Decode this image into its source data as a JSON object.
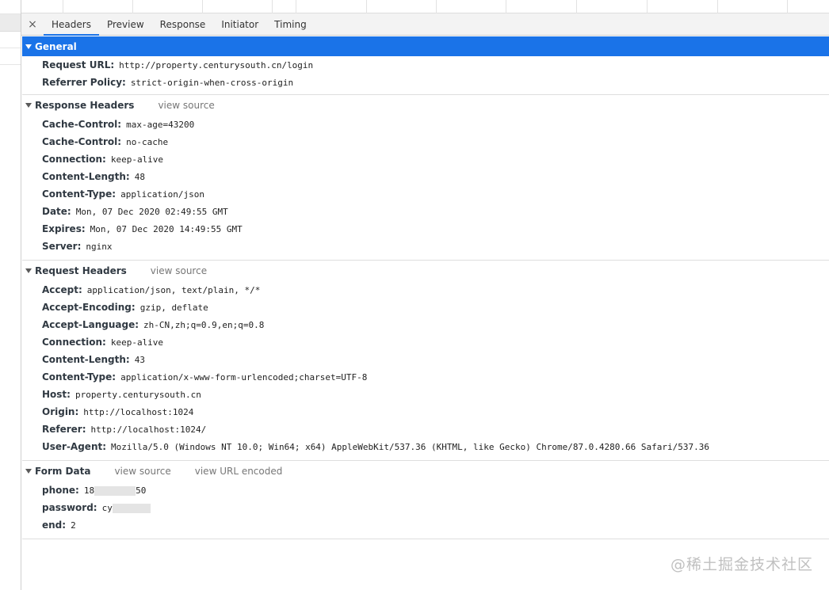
{
  "tabs": {
    "close": "×",
    "items": [
      "Headers",
      "Preview",
      "Response",
      "Initiator",
      "Timing"
    ],
    "active": "Headers"
  },
  "general": {
    "title": "General",
    "rows": [
      {
        "key": "Request URL:",
        "value": "http://property.centurysouth.cn/login"
      },
      {
        "key": "Referrer Policy:",
        "value": "strict-origin-when-cross-origin"
      }
    ]
  },
  "response_headers": {
    "title": "Response Headers",
    "view_source": "view source",
    "rows": [
      {
        "key": "Cache-Control:",
        "value": "max-age=43200"
      },
      {
        "key": "Cache-Control:",
        "value": "no-cache"
      },
      {
        "key": "Connection:",
        "value": "keep-alive"
      },
      {
        "key": "Content-Length:",
        "value": "48"
      },
      {
        "key": "Content-Type:",
        "value": "application/json"
      },
      {
        "key": "Date:",
        "value": "Mon, 07 Dec 2020 02:49:55 GMT"
      },
      {
        "key": "Expires:",
        "value": "Mon, 07 Dec 2020 14:49:55 GMT"
      },
      {
        "key": "Server:",
        "value": "nginx"
      }
    ]
  },
  "request_headers": {
    "title": "Request Headers",
    "view_source": "view source",
    "rows": [
      {
        "key": "Accept:",
        "value": "application/json, text/plain, */*"
      },
      {
        "key": "Accept-Encoding:",
        "value": "gzip, deflate"
      },
      {
        "key": "Accept-Language:",
        "value": "zh-CN,zh;q=0.9,en;q=0.8"
      },
      {
        "key": "Connection:",
        "value": "keep-alive"
      },
      {
        "key": "Content-Length:",
        "value": "43"
      },
      {
        "key": "Content-Type:",
        "value": "application/x-www-form-urlencoded;charset=UTF-8"
      },
      {
        "key": "Host:",
        "value": "property.centurysouth.cn"
      },
      {
        "key": "Origin:",
        "value": "http://localhost:1024"
      },
      {
        "key": "Referer:",
        "value": "http://localhost:1024/"
      },
      {
        "key": "User-Agent:",
        "value": "Mozilla/5.0 (Windows NT 10.0; Win64; x64) AppleWebKit/537.36 (KHTML, like Gecko) Chrome/87.0.4280.66 Safari/537.36"
      }
    ]
  },
  "form_data": {
    "title": "Form Data",
    "view_source": "view source",
    "view_url_encoded": "view URL encoded",
    "rows": [
      {
        "key": "phone:",
        "value_prefix": "18",
        "value_suffix": "50"
      },
      {
        "key": "password:",
        "value_prefix": "cy",
        "value_suffix": ""
      },
      {
        "key": "end:",
        "value_prefix": "2",
        "value_suffix": ""
      }
    ]
  },
  "watermark": "@稀土掘金技术社区",
  "colors": {
    "selected_header": "#1a73e8",
    "tab_underline": "#1a73e8",
    "link_gray": "#777777"
  }
}
